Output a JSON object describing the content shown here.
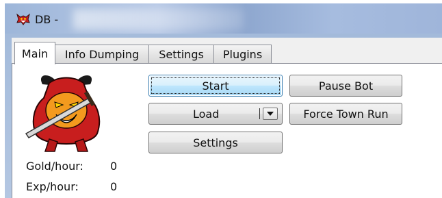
{
  "window": {
    "title": "DB -",
    "app_icon": "demon-icon"
  },
  "tabs": [
    {
      "label": "Main",
      "active": true
    },
    {
      "label": "Info Dumping",
      "active": false
    },
    {
      "label": "Settings",
      "active": false
    },
    {
      "label": "Plugins",
      "active": false
    }
  ],
  "main": {
    "logo_icon": "demon-logo-icon",
    "buttons": {
      "start": "Start",
      "pause": "Pause Bot",
      "load": "Load",
      "force_town_run": "Force Town Run",
      "settings": "Settings"
    },
    "stats": [
      {
        "label": "Gold/hour:",
        "value": "0"
      },
      {
        "label": "Exp/hour:",
        "value": "0"
      }
    ]
  },
  "colors": {
    "focus_blue": "#3c7fb1",
    "demon_red": "#c81e1e",
    "titlebar_blue": "#9db6d9"
  }
}
